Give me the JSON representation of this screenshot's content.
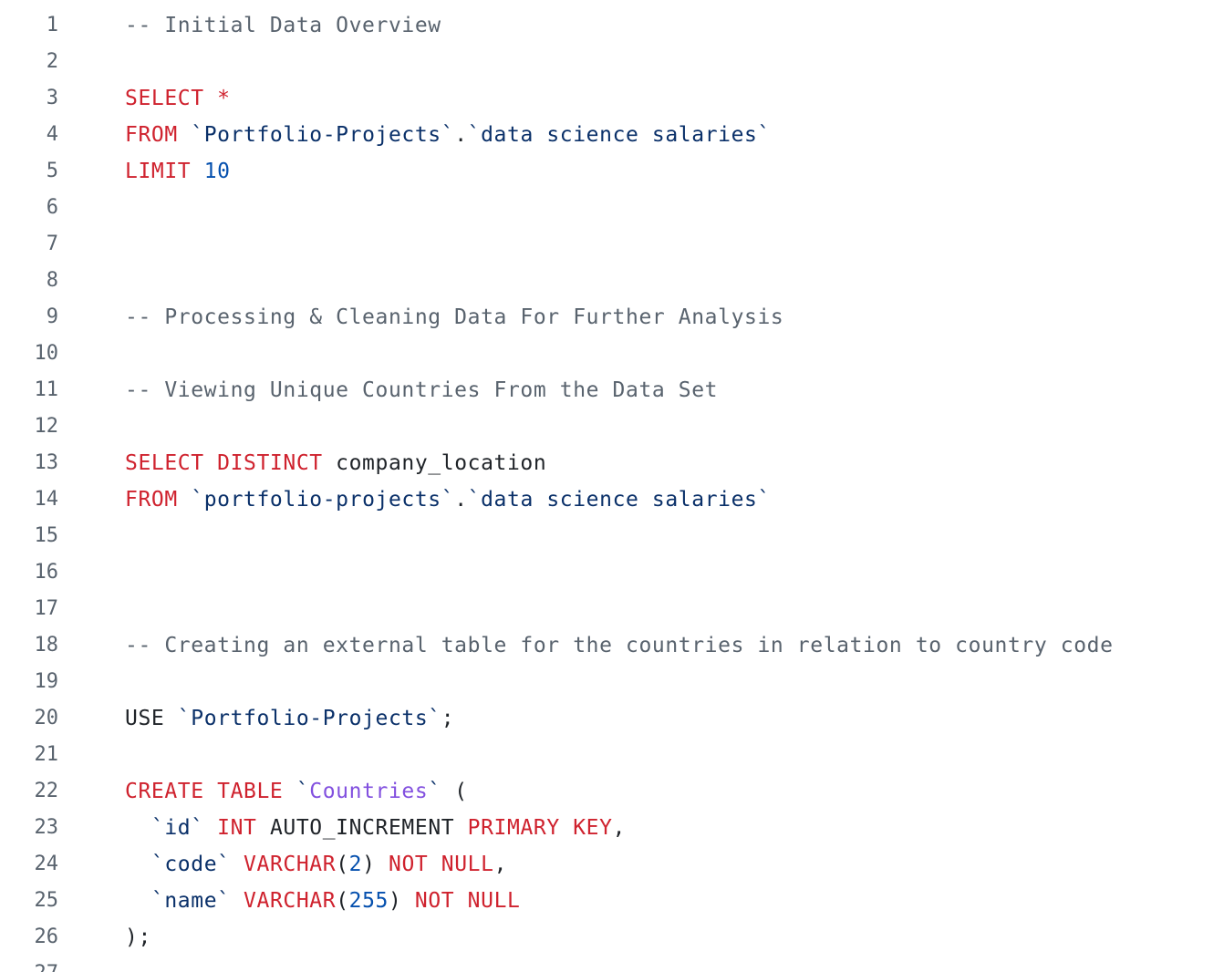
{
  "colors": {
    "background": "#ffffff",
    "line_number": "#59636e",
    "comment": "#59636e",
    "keyword": "#cf222e",
    "identifier": "#0a3069",
    "number": "#0550ae",
    "entity": "#8250df",
    "plain": "#1f2328"
  },
  "lines": [
    {
      "n": "1",
      "tokens": [
        {
          "t": "c",
          "v": "-- Initial Data Overview"
        }
      ]
    },
    {
      "n": "2",
      "tokens": []
    },
    {
      "n": "3",
      "tokens": [
        {
          "t": "k",
          "v": "SELECT *"
        }
      ]
    },
    {
      "n": "4",
      "tokens": [
        {
          "t": "k",
          "v": "FROM"
        },
        {
          "t": "p",
          "v": " "
        },
        {
          "t": "i",
          "v": "`Portfolio-Projects`"
        },
        {
          "t": "p",
          "v": "."
        },
        {
          "t": "i",
          "v": "`data science salaries`"
        }
      ]
    },
    {
      "n": "5",
      "tokens": [
        {
          "t": "k",
          "v": "LIMIT"
        },
        {
          "t": "p",
          "v": " "
        },
        {
          "t": "n",
          "v": "10"
        }
      ]
    },
    {
      "n": "6",
      "tokens": []
    },
    {
      "n": "7",
      "tokens": []
    },
    {
      "n": "8",
      "tokens": []
    },
    {
      "n": "9",
      "tokens": [
        {
          "t": "c",
          "v": "-- Processing & Cleaning Data For Further Analysis"
        }
      ]
    },
    {
      "n": "10",
      "tokens": []
    },
    {
      "n": "11",
      "tokens": [
        {
          "t": "c",
          "v": "-- Viewing Unique Countries From the Data Set"
        }
      ]
    },
    {
      "n": "12",
      "tokens": []
    },
    {
      "n": "13",
      "tokens": [
        {
          "t": "k",
          "v": "SELECT DISTINCT"
        },
        {
          "t": "p",
          "v": " company_location"
        }
      ]
    },
    {
      "n": "14",
      "tokens": [
        {
          "t": "k",
          "v": "FROM"
        },
        {
          "t": "p",
          "v": " "
        },
        {
          "t": "i",
          "v": "`portfolio-projects`"
        },
        {
          "t": "p",
          "v": "."
        },
        {
          "t": "i",
          "v": "`data science salaries`"
        }
      ]
    },
    {
      "n": "15",
      "tokens": []
    },
    {
      "n": "16",
      "tokens": []
    },
    {
      "n": "17",
      "tokens": []
    },
    {
      "n": "18",
      "tokens": [
        {
          "t": "c",
          "v": "-- Creating an external table for the countries in relation to country code"
        }
      ]
    },
    {
      "n": "19",
      "tokens": []
    },
    {
      "n": "20",
      "tokens": [
        {
          "t": "p",
          "v": "USE "
        },
        {
          "t": "i",
          "v": "`Portfolio-Projects`"
        },
        {
          "t": "p",
          "v": ";"
        }
      ]
    },
    {
      "n": "21",
      "tokens": []
    },
    {
      "n": "22",
      "tokens": [
        {
          "t": "k",
          "v": "CREATE TABLE"
        },
        {
          "t": "p",
          "v": " "
        },
        {
          "t": "i",
          "v": "`"
        },
        {
          "t": "e",
          "v": "Countries"
        },
        {
          "t": "i",
          "v": "`"
        },
        {
          "t": "p",
          "v": " ("
        }
      ]
    },
    {
      "n": "23",
      "tokens": [
        {
          "t": "p",
          "v": "  "
        },
        {
          "t": "i",
          "v": "`id`"
        },
        {
          "t": "p",
          "v": " "
        },
        {
          "t": "k",
          "v": "INT"
        },
        {
          "t": "p",
          "v": " AUTO_INCREMENT "
        },
        {
          "t": "k",
          "v": "PRIMARY KEY"
        },
        {
          "t": "p",
          "v": ","
        }
      ]
    },
    {
      "n": "24",
      "tokens": [
        {
          "t": "p",
          "v": "  "
        },
        {
          "t": "i",
          "v": "`code`"
        },
        {
          "t": "p",
          "v": " "
        },
        {
          "t": "k",
          "v": "VARCHAR"
        },
        {
          "t": "p",
          "v": "("
        },
        {
          "t": "n",
          "v": "2"
        },
        {
          "t": "p",
          "v": ") "
        },
        {
          "t": "k",
          "v": "NOT NULL"
        },
        {
          "t": "p",
          "v": ","
        }
      ]
    },
    {
      "n": "25",
      "tokens": [
        {
          "t": "p",
          "v": "  "
        },
        {
          "t": "i",
          "v": "`name`"
        },
        {
          "t": "p",
          "v": " "
        },
        {
          "t": "k",
          "v": "VARCHAR"
        },
        {
          "t": "p",
          "v": "("
        },
        {
          "t": "n",
          "v": "255"
        },
        {
          "t": "p",
          "v": ") "
        },
        {
          "t": "k",
          "v": "NOT NULL"
        }
      ]
    },
    {
      "n": "26",
      "tokens": [
        {
          "t": "p",
          "v": ");"
        }
      ]
    },
    {
      "n": "27",
      "tokens": []
    }
  ]
}
